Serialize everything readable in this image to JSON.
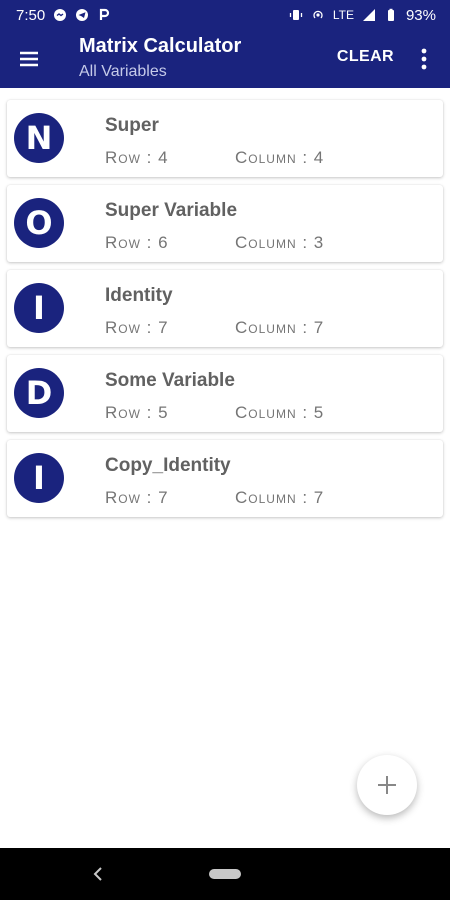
{
  "status_bar": {
    "time": "7:50",
    "lte": "LTE",
    "battery": "93%",
    "left_icons": [
      "signal-messenger-icon",
      "telegram-icon",
      "parking-p-icon"
    ],
    "right_icons": [
      "vibrate-icon",
      "hotspot-icon",
      "signal-icon",
      "battery-icon"
    ]
  },
  "app_bar": {
    "title": "Matrix Calculator",
    "subtitle": "All Variables",
    "clear_label": "CLEAR",
    "menu_icon": "hamburger-menu-icon",
    "overflow_icon": "more-vert-icon"
  },
  "variables": [
    {
      "letter": "N",
      "name": "Super",
      "row_text": "Row : 4",
      "column_text": "Column : 4"
    },
    {
      "letter": "O",
      "name": "Super Variable",
      "row_text": "Row : 6",
      "column_text": "Column : 3"
    },
    {
      "letter": "I",
      "name": "Identity",
      "row_text": "Row : 7",
      "column_text": "Column : 7"
    },
    {
      "letter": "D",
      "name": "Some Variable",
      "row_text": "Row : 5",
      "column_text": "Column : 5"
    },
    {
      "letter": "I",
      "name": "Copy_Identity",
      "row_text": "Row : 7",
      "column_text": "Column : 7"
    }
  ],
  "fab": {
    "icon": "plus-icon"
  },
  "colors": {
    "primary": "#1a237e",
    "subtitle": "#c5cae9",
    "text_secondary": "#757575"
  }
}
